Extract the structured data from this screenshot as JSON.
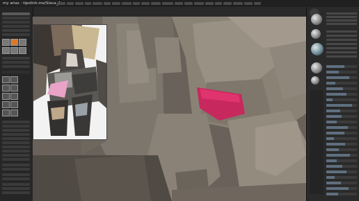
{
  "window": {
    "title": "my arias - tipolink.me/Slava_Axe"
  },
  "viewport_label": "3D model viewport",
  "colors": {
    "accent": "#d9792b",
    "highlight": "#e0346e",
    "clay": "#7b736a"
  }
}
